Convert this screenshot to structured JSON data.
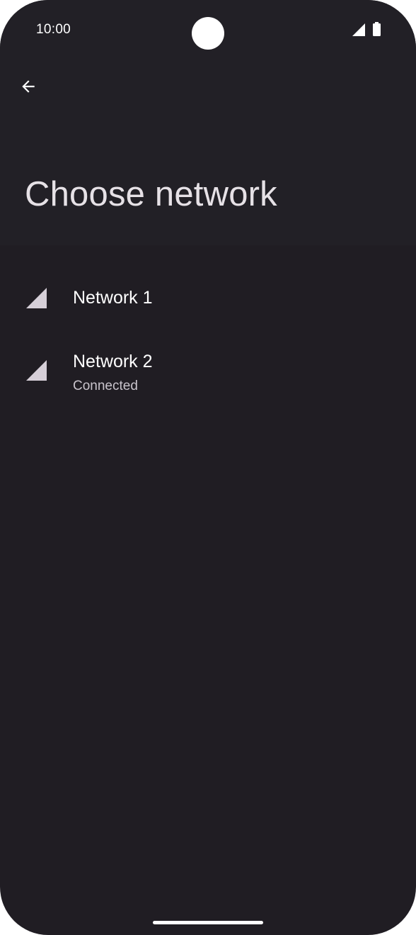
{
  "status_bar": {
    "time": "10:00"
  },
  "header": {
    "back_icon": "arrow-back-icon",
    "title": "Choose network"
  },
  "networks": [
    {
      "name": "Network 1",
      "status": "",
      "icon": "signal-icon"
    },
    {
      "name": "Network 2",
      "status": "Connected",
      "icon": "signal-icon"
    }
  ],
  "colors": {
    "background": "#201d23",
    "header_background": "#222026",
    "title_text": "#e6e1e6",
    "primary_text": "#ffffff",
    "secondary_text": "#c9c4cc",
    "signal_icon": "#d6cfd8"
  }
}
